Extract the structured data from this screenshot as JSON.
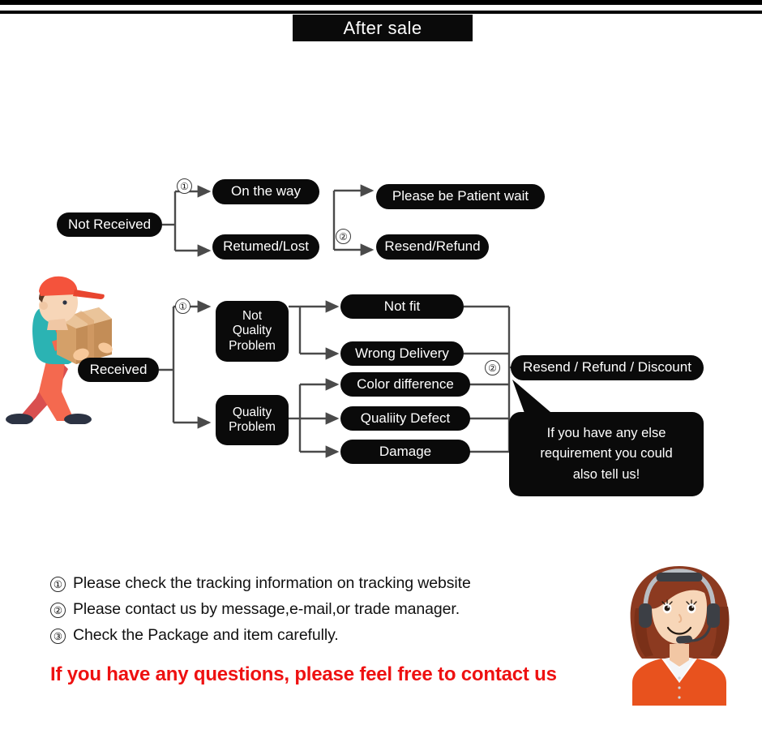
{
  "header": {
    "title": "After sale"
  },
  "flow_top": {
    "root": "Not Received",
    "marker_1": "①",
    "marker_2": "②",
    "branches": [
      "On the way",
      "Retumed/Lost"
    ],
    "outcomes": [
      "Please be Patient wait",
      "Resend/Refund"
    ]
  },
  "flow_bottom": {
    "root": "Received",
    "marker_1": "①",
    "marker_2": "②",
    "categories": [
      "Not\nQuality\nProblem",
      "Quality\nProblem"
    ],
    "category_lines": [
      [
        "Not",
        "Quality",
        "Problem"
      ],
      [
        "Quality",
        "Problem"
      ]
    ],
    "reasons": [
      "Not fit",
      "Wrong Delivery",
      "Color difference",
      "Qualiity Defect",
      "Damage"
    ],
    "outcome": "Resend / Refund / Discount",
    "bubble_lines": [
      "If you have any else",
      "requirement you could",
      "also tell us!"
    ]
  },
  "notes": [
    {
      "num": "①",
      "text": "Please check the tracking information on tracking website"
    },
    {
      "num": "②",
      "text": "Please contact us by message,e-mail,or trade manager."
    },
    {
      "num": "③",
      "text": "Check the Package and item carefully."
    }
  ],
  "cta": "If you have any questions, please feel free to contact us",
  "colors": {
    "box_fill": "#0a0a0a",
    "box_text": "#ffffff",
    "connector": "#4a4a4a",
    "cta_red": "#ee1111",
    "courier_shirt": "#2bb3b3",
    "courier_cap": "#f4533c",
    "courier_pants": "#f4694f",
    "courier_box": "#d9a36a",
    "agent_hair": "#8c3a20",
    "agent_shirt": "#e8521e",
    "agent_skin": "#f7d6b8"
  },
  "icons": {
    "courier": "delivery-person-icon",
    "agent": "customer-service-agent-icon"
  }
}
